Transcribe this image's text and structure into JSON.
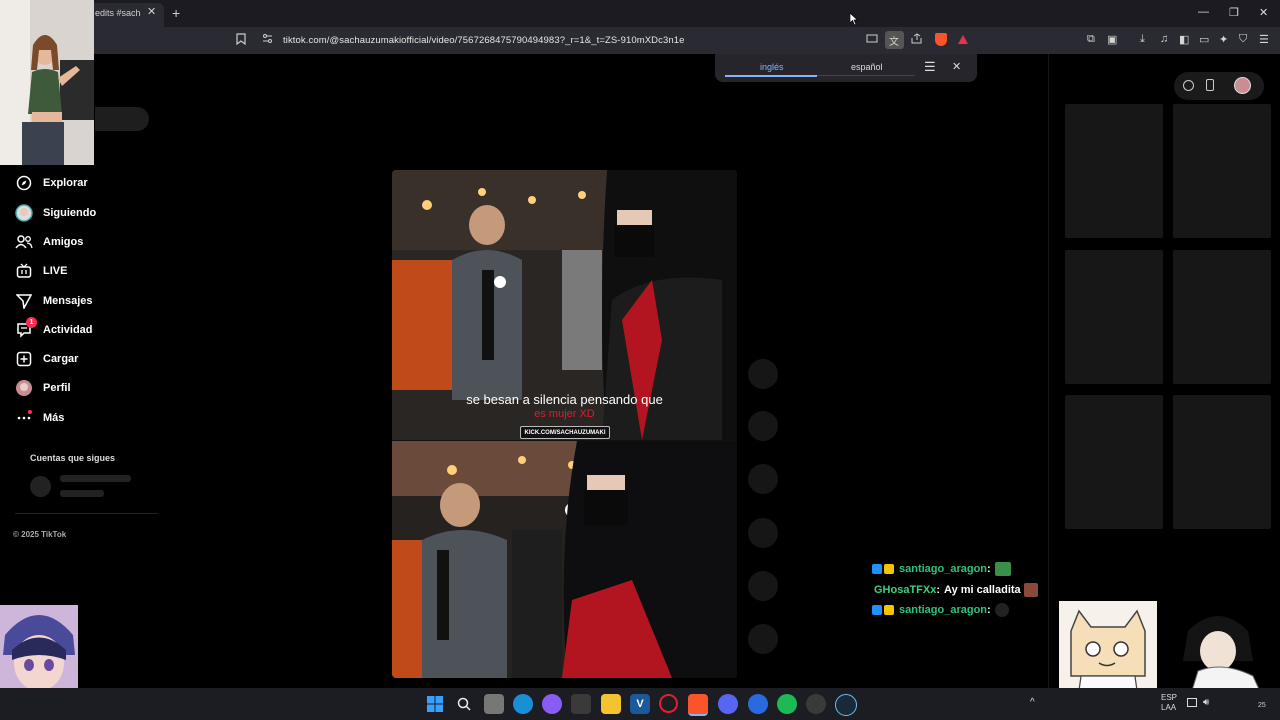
{
  "browser": {
    "tab_title": "edits #sachau",
    "tab_close": "✕",
    "new_tab": "+",
    "url": "tiktok.com/@sachauzumakiofficial/video/7567268475790494983?_r=1&_t=ZS-910mXDc3n1e",
    "window_controls": {
      "minimize": "—",
      "restore": "❐",
      "close": "✕"
    }
  },
  "translate_popup": {
    "source_language": "inglés",
    "target_language": "español",
    "menu_icon": "☰",
    "close_icon": "✕"
  },
  "sidebar": {
    "items": [
      {
        "label": "Explorar",
        "icon": "compass-icon"
      },
      {
        "label": "Siguiendo",
        "icon": "avatar-icon"
      },
      {
        "label": "Amigos",
        "icon": "friends-icon"
      },
      {
        "label": "LIVE",
        "icon": "live-tv-icon"
      },
      {
        "label": "Mensajes",
        "icon": "send-icon"
      },
      {
        "label": "Actividad",
        "icon": "activity-icon",
        "badge": "1"
      },
      {
        "label": "Cargar",
        "icon": "upload-icon"
      },
      {
        "label": "Perfil",
        "icon": "profile-icon"
      },
      {
        "label": "Más",
        "icon": "more-icon"
      }
    ],
    "following_title": "Cuentas que sigues",
    "copyright": "© 2025 TikTok"
  },
  "video": {
    "subtitle_line1": "se besan a silencia pensando que",
    "subtitle_line2": "es mujer XD",
    "kick_tag": "KICK.COM/SACHAUZUMAKI"
  },
  "chat": [
    {
      "user": "santiago_aragon",
      "sep": " :",
      "message": "",
      "color": "#2ec27e"
    },
    {
      "user": "GHosaTFXx",
      "sep": " :",
      "message": "Ay mi calladita",
      "color": "#3fd17a"
    },
    {
      "user": "santiago_aragon",
      "sep": " :",
      "message": "",
      "color": "#2ec27e"
    }
  ],
  "taskbar": {
    "language_line1": "ESP",
    "language_line2": "LAA",
    "tray_up": "^",
    "clock_fragment": "25"
  }
}
